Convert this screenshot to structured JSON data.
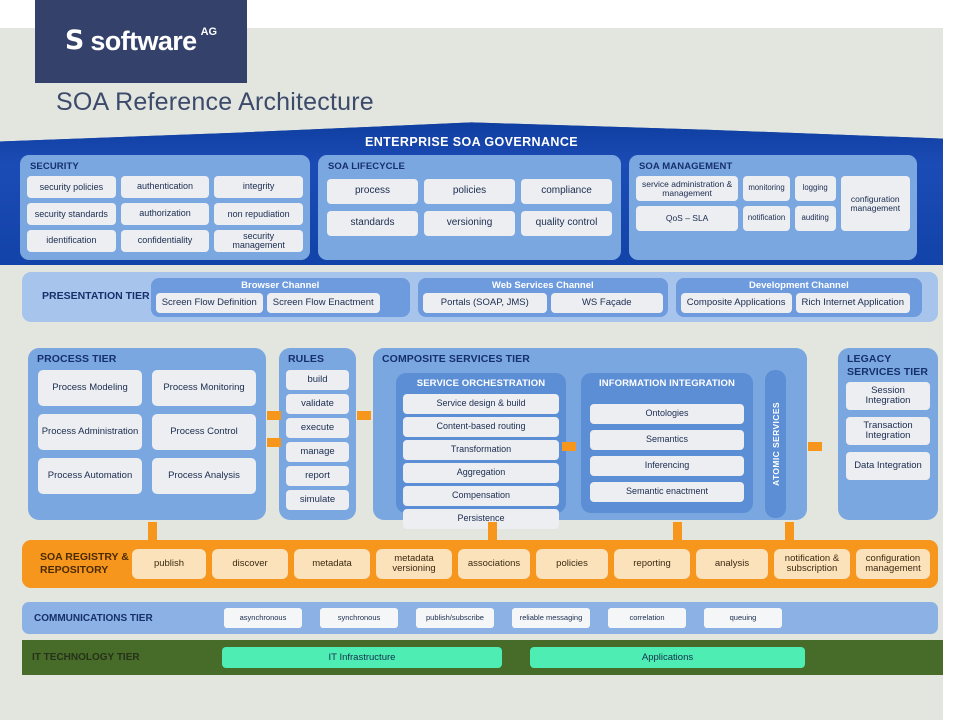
{
  "brand": {
    "logo_mark": "S",
    "logo_word": "software",
    "logo_suffix": "AG"
  },
  "page_title": "SOA Reference Architecture",
  "governance": {
    "title": "ENTERPRISE SOA GOVERNANCE",
    "groups": [
      {
        "title": "SECURITY",
        "items": [
          "security policies",
          "authentication",
          "integrity",
          "security standards",
          "authorization",
          "non repudiation",
          "identification",
          "confidentiality",
          "security management"
        ]
      },
      {
        "title": "SOA LIFECYCLE",
        "items": [
          "process",
          "policies",
          "compliance",
          "standards",
          "versioning",
          "quality control"
        ]
      },
      {
        "title": "SOA MANAGEMENT",
        "items": [
          "service administration & management",
          "monitoring",
          "logging",
          "QoS – SLA",
          "notification",
          "auditing",
          "configuration management"
        ]
      }
    ]
  },
  "presentation_tier": {
    "label": "PRESENTATION TIER",
    "channels": [
      {
        "title": "Browser Channel",
        "items": [
          "Screen Flow Definition",
          "Screen Flow Enactment"
        ]
      },
      {
        "title": "Web Services Channel",
        "items": [
          "Portals (SOAP, JMS)",
          "WS Façade"
        ]
      },
      {
        "title": "Development Channel",
        "items": [
          "Composite Applications",
          "Rich Internet Application"
        ]
      }
    ]
  },
  "process_tier": {
    "title": "PROCESS TIER",
    "items": [
      "Process Modeling",
      "Process Monitoring",
      "Process Administration",
      "Process Control",
      "Process Automation",
      "Process Analysis"
    ]
  },
  "rules_tier": {
    "title": "RULES",
    "items": [
      "build",
      "validate",
      "execute",
      "manage",
      "report",
      "simulate"
    ]
  },
  "composite_services_tier": {
    "title": "COMPOSITE SERVICES TIER",
    "orchestration": {
      "title": "SERVICE ORCHESTRATION",
      "items": [
        "Service design & build",
        "Content-based routing",
        "Transformation",
        "Aggregation",
        "Compensation",
        "Persistence"
      ]
    },
    "information_integration": {
      "title": "INFORMATION INTEGRATION",
      "items": [
        "Ontologies",
        "Semantics",
        "Inferencing",
        "Semantic enactment"
      ]
    },
    "atomic_services": "ATOMIC SERVICES"
  },
  "legacy_services_tier": {
    "title": "LEGACY SERVICES TIER",
    "items": [
      "Session Integration",
      "Transaction Integration",
      "Data Integration"
    ]
  },
  "registry": {
    "label": "SOA REGISTRY & REPOSITORY",
    "items": [
      "publish",
      "discover",
      "metadata",
      "metadata versioning",
      "associations",
      "policies",
      "reporting",
      "analysis",
      "notification & subscription",
      "configuration management"
    ]
  },
  "communications_tier": {
    "label": "COMMUNICATIONS TIER",
    "items": [
      "asynchronous",
      "synchronous",
      "publish/subscribe",
      "reliable messaging",
      "correlation",
      "queuing"
    ]
  },
  "it_technology_tier": {
    "label": "IT TECHNOLOGY TIER",
    "items": [
      "IT Infrastructure",
      "Applications"
    ]
  },
  "colors": {
    "brand_navy": "#34416b",
    "governance_blue": "#1243a8",
    "tier_blue": "#7ba7e0",
    "accent_orange": "#f7961d",
    "it_green": "#476b28",
    "it_chip_green": "#4dedb4",
    "page_bg": "#e3e6de"
  }
}
